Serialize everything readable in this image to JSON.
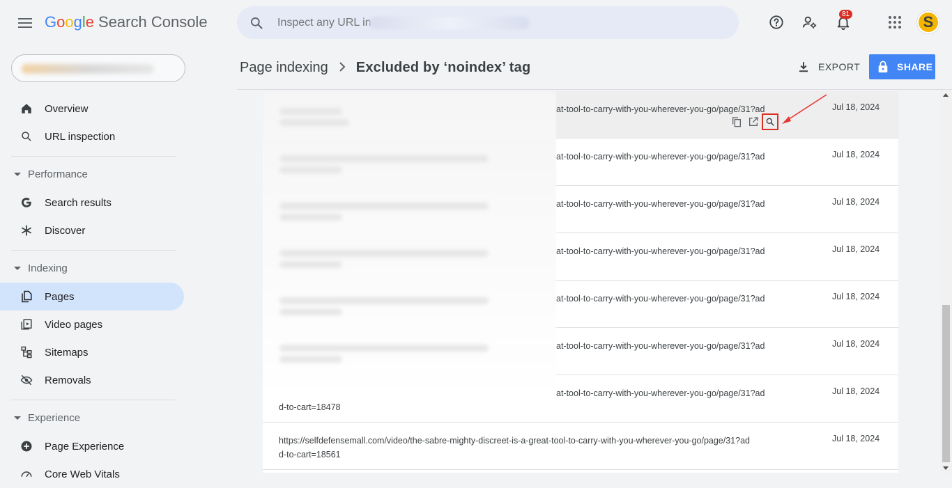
{
  "app": {
    "logo_google": [
      "G",
      "o",
      "o",
      "g",
      "l",
      "e"
    ],
    "product_name": "Search Console"
  },
  "search": {
    "placeholder": "Inspect any URL in"
  },
  "notifications": {
    "count": "81"
  },
  "account": {
    "avatar_letter": "S",
    "avatar_color": "#f4b400"
  },
  "sidebar": {
    "items": [
      {
        "label": "Overview",
        "icon": "home-icon"
      },
      {
        "label": "URL inspection",
        "icon": "search-icon"
      },
      {
        "label": "Search results",
        "icon": "google-g-icon"
      },
      {
        "label": "Discover",
        "icon": "asterisk-icon"
      },
      {
        "label": "Pages",
        "icon": "pages-icon",
        "active": true
      },
      {
        "label": "Video pages",
        "icon": "video-pages-icon"
      },
      {
        "label": "Sitemaps",
        "icon": "sitemap-icon"
      },
      {
        "label": "Removals",
        "icon": "eye-off-icon"
      },
      {
        "label": "Page Experience",
        "icon": "plus-circle-icon"
      },
      {
        "label": "Core Web Vitals",
        "icon": "gauge-icon"
      }
    ],
    "sections": [
      "Performance",
      "Indexing",
      "Experience"
    ]
  },
  "header": {
    "breadcrumb_parent": "Page indexing",
    "breadcrumb_current": "Excluded by ‘noindex’ tag",
    "export_label": "EXPORT",
    "share_label": "SHARE",
    "accent_color": "#4285f4"
  },
  "table": {
    "rows": [
      {
        "url": "at-tool-to-carry-with-you-wherever-you-go/page/31?ad",
        "date": "Jul 18, 2024",
        "hover": true
      },
      {
        "url": "at-tool-to-carry-with-you-wherever-you-go/page/31?ad",
        "date": "Jul 18, 2024"
      },
      {
        "url": "at-tool-to-carry-with-you-wherever-you-go/page/31?ad",
        "date": "Jul 18, 2024"
      },
      {
        "url": "at-tool-to-carry-with-you-wherever-you-go/page/31?ad",
        "date": "Jul 18, 2024"
      },
      {
        "url": "at-tool-to-carry-with-you-wherever-you-go/page/31?ad",
        "date": "Jul 18, 2024"
      },
      {
        "url": "at-tool-to-carry-with-you-wherever-you-go/page/31?ad",
        "date": "Jul 18, 2024"
      },
      {
        "url": "at-tool-to-carry-with-you-wherever-you-go/page/31?ad",
        "url_line2": "d-to-cart=18478",
        "date": "Jul 18, 2024"
      },
      {
        "url": "https://selfdefensemall.com/video/the-sabre-mighty-discreet-is-a-great-tool-to-carry-with-you-wherever-you-go/page/31?ad",
        "url_line2": "d-to-cart=18561",
        "date": "Jul 18, 2024"
      }
    ],
    "row_actions": [
      "copy-icon",
      "open-in-new-icon",
      "inspect-url-icon"
    ],
    "highlight_color": "#d93025"
  }
}
